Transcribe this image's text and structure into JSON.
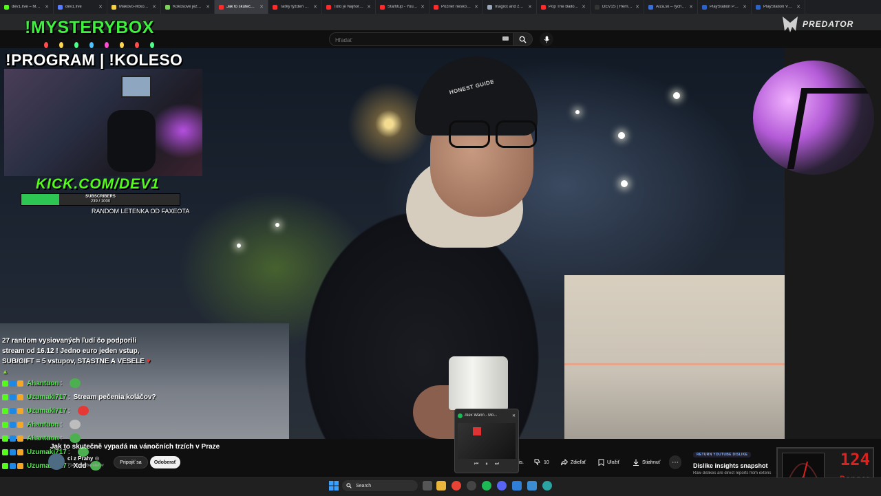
{
  "tabs": [
    {
      "title": "dev1.live – MYSTERY",
      "color": "#53fc18",
      "active": false
    },
    {
      "title": "dev1.live",
      "color": "#5a7cff",
      "active": false
    },
    {
      "title": "Makovo-vlčková li",
      "color": "#f5d142",
      "active": false
    },
    {
      "title": "Kokosové ježci | Pre",
      "color": "#7dd35a",
      "active": false
    },
    {
      "title": "Jak to skutečně vyp",
      "color": "#ff2b2b",
      "active": true
    },
    {
      "title": "Taťký týždeň Krejz",
      "color": "#ff2b2b",
      "active": false
    },
    {
      "title": "Toto je Najhoršie H",
      "color": "#ff2b2b",
      "active": false
    },
    {
      "title": "Startitup - YouTube",
      "color": "#ff2b2b",
      "active": false
    },
    {
      "title": "Pozrieť neskôr - You",
      "color": "#ff2b2b",
      "active": false
    },
    {
      "title": "magixx and zonti1v",
      "color": "#9aa7b8",
      "active": false
    },
    {
      "title": "Pop The Balloon or",
      "color": "#ff2b2b",
      "active": false
    },
    {
      "title": "DEV1S | Herné ukoi",
      "color": "#333333",
      "active": false
    },
    {
      "title": "Alza.sk – rýchly a p",
      "color": "#3b6fd8",
      "active": false
    },
    {
      "title": "PlayStation Portal R",
      "color": "#2b63c9",
      "active": false
    },
    {
      "title": "PlayStation VR2 zo",
      "color": "#2b63c9",
      "active": false
    }
  ],
  "youtube": {
    "search_placeholder": "Hľadať",
    "video_title": "Jak to skutečně vypadá na vánočních trzích v Praze",
    "channel_name": "ci z Prahy",
    "channel_subs": "714 tis. odberateľov",
    "join_label": "Pripojiť sa",
    "subscribe_label": "Odoberať",
    "like_tail": "tis.",
    "dislike_count": "10",
    "share_label": "Zdieľať",
    "save_label": "Uložiť",
    "download_label": "Stiahnuť"
  },
  "brand": {
    "predator": "PREDATOR"
  },
  "overlay": {
    "mysterybox": "!MYSTERYBOX",
    "program": "!PROGRAM | !KOLESO",
    "kick": "KICK.COM/DEV1",
    "subs_label": "SUBSCRIBERS",
    "subs_count": "239 / 1000",
    "subs_progress": 0.239,
    "random_text": "RANDOM LETENKA OD FAXEOTA",
    "beanie_text": "HONEST GUIDE"
  },
  "chat": {
    "announcement_lines": [
      "27 random vysiovaných ľudí čo podporili",
      "stream od 16.12 ! Jedno euro jeden vstup,",
      "SUB/GIFT = 5 vstupov, STASTNE A VESELE"
    ],
    "messages": [
      {
        "user": "Ahantuon",
        "text": ""
      },
      {
        "user": "Uzumaki717",
        "text": "Stream pečenia koláčov?"
      },
      {
        "user": "Uzumaki717",
        "text": ""
      },
      {
        "user": "Ahantuon",
        "text": ""
      },
      {
        "user": "Ahantuon",
        "text": ""
      },
      {
        "user": "Uzumaki717",
        "text": ""
      },
      {
        "user": "Uzumaki717",
        "text": "Xdd"
      }
    ]
  },
  "miniplayer": {
    "title": "Alex Wann - Mo..."
  },
  "ryd": {
    "badge": "RETURN YOUTUBE DISLIKE",
    "title": "Dislike insights snapshot",
    "desc": "Raw dislikes are direct reports from extens"
  },
  "danger": {
    "value": "124",
    "label": "Danger"
  },
  "taskbar": {
    "search_label": "Search"
  }
}
